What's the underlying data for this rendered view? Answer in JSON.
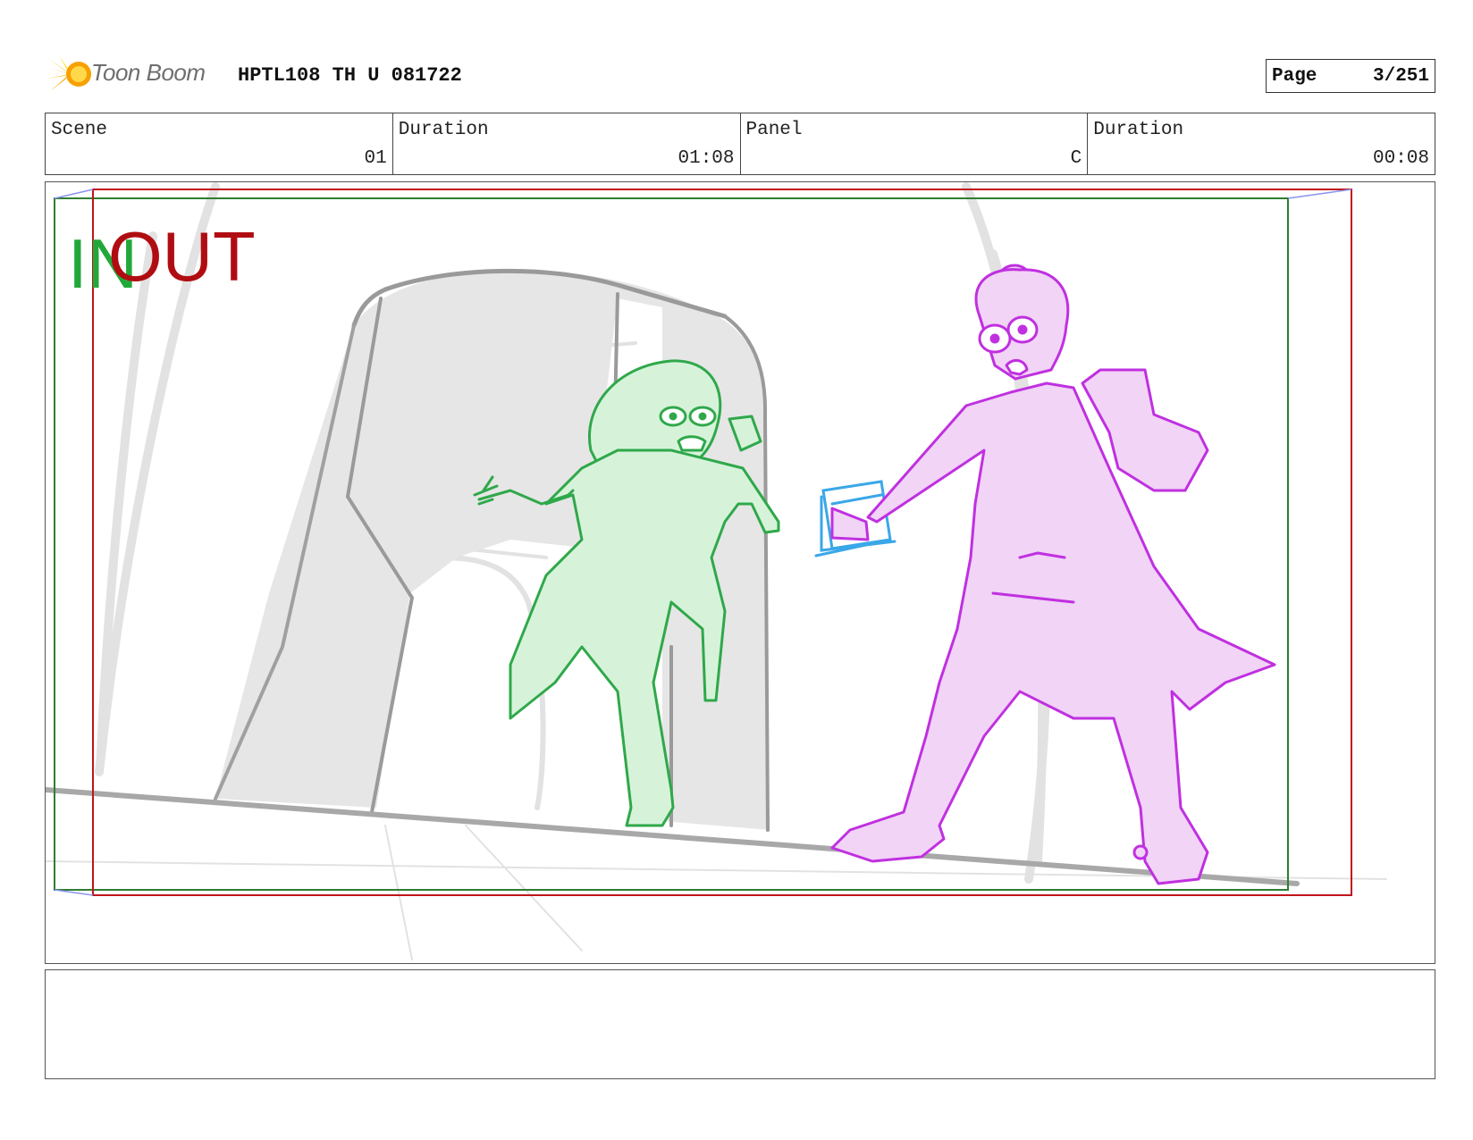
{
  "header": {
    "logo_text": "Toon Boom",
    "doc_title": "HPTL108 TH U 081722",
    "page_label": "Page",
    "page_value": "3/251"
  },
  "info": {
    "scene_label": "Scene",
    "scene_value": "01",
    "duration_label": "Duration",
    "duration_value": "01:08",
    "panel_label": "Panel",
    "panel_value": "C",
    "panel_duration_label": "Duration",
    "panel_duration_value": "00:08"
  },
  "panel": {
    "in_label": "IN",
    "out_label": "OUT",
    "colors": {
      "in_frame": "#2f7d32",
      "out_frame": "#c0141c",
      "character_left": "#2fa84a",
      "character_right": "#c030e0",
      "prop": "#3aa7e8",
      "background": "#9a9a9a"
    }
  },
  "notes": {
    "text": ""
  }
}
